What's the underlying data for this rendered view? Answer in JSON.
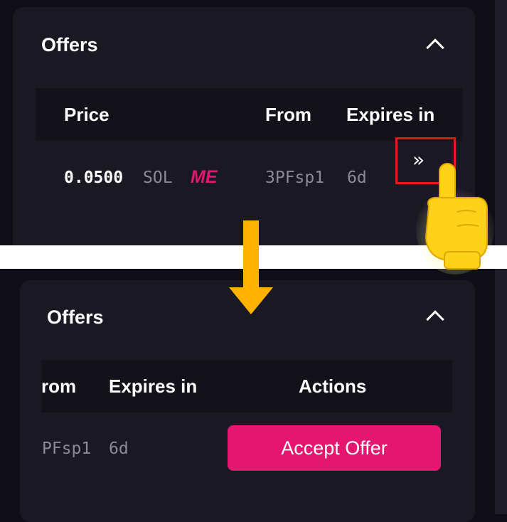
{
  "top_panel": {
    "title": "Offers",
    "headers": {
      "price": "Price",
      "from": "From",
      "expires": "Expires in"
    },
    "row": {
      "price": "0.0500",
      "currency": "SOL",
      "marketplace_logo": "ME",
      "from": "3PFsp1",
      "expires": "6d"
    },
    "expand_label": "»"
  },
  "bottom_panel": {
    "title": "Offers",
    "headers": {
      "from": "rom",
      "expires": "Expires in",
      "actions": "Actions"
    },
    "row": {
      "from": "PFsp1",
      "expires": "6d",
      "action_label": "Accept Offer"
    }
  },
  "colors": {
    "accent": "#e4166f",
    "arrow": "#ffb300",
    "highlight": "#e21a1a",
    "panel": "#1a1923"
  },
  "icons": {
    "collapse": "chevron-up-icon",
    "expand": "double-chevron-right-icon",
    "pointer": "pointing-hand-icon",
    "transition": "down-arrow-icon"
  }
}
